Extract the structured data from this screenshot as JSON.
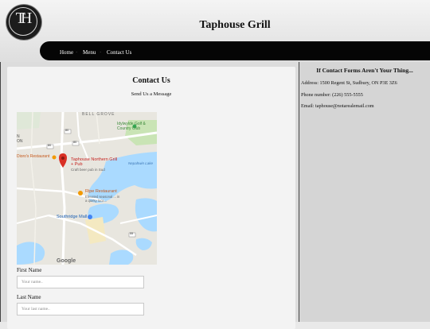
{
  "header": {
    "logo_letters": "TH",
    "site_title": "Taphouse Grill"
  },
  "nav": {
    "items": [
      {
        "label": "Home"
      },
      {
        "label": "Menu"
      },
      {
        "label": "Contact Us"
      }
    ]
  },
  "main": {
    "heading": "Contact Us",
    "subheading": "Send Us a Message",
    "map": {
      "labels": {
        "area_top": "BELL GROVE",
        "golf": "Idylwylde Golf & Country Club",
        "taphouse_name": "Taphouse Northern Grill + Pub",
        "taphouse_desc": "Craft beer pub in Sud",
        "left_restaurant": "Dioro's Restaurant",
        "ripe_name": "Ripe Restaurant",
        "ripe_desc": "Elevated seasonal ... in a quirky loca...",
        "southridge": "Southridge Mall",
        "nepahwin": "Nepahwin Lake",
        "road_80a": "80",
        "road_80b": "80",
        "road_80c": "80",
        "road_55": "55",
        "left_edge": "N ON",
        "attribution": "Google"
      }
    },
    "form": {
      "first_name_label": "First Name",
      "first_name_placeholder": "Your name..",
      "last_name_label": "Last Name",
      "last_name_placeholder": "Your last name.."
    }
  },
  "aside": {
    "heading": "If Contact Forms Aren't Your Thing...",
    "address": "Address: 1500 Regent St, Sudbury, ON P3E 3Z6",
    "phone": "Phone number: (226) 555-5555",
    "email": "Email: taphouse@notarealemail.com"
  },
  "colors": {
    "navbar": "#050505",
    "map_water": "#aadaff",
    "map_land": "#e8e6df",
    "map_park": "#c9e4b5",
    "map_pin": "#d93025"
  }
}
